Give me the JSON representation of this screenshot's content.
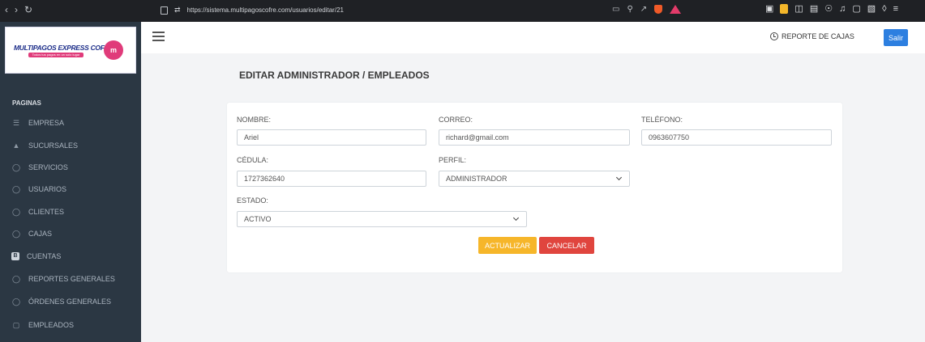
{
  "browser": {
    "url": "https://sistema.multipagoscofre.com/usuarios/editar/21"
  },
  "logo": {
    "title": "MULTIPAGOS EXPRESS COFRE",
    "tagline": "Todos tus pagos en un solo lugar",
    "badge": "m"
  },
  "sidebar": {
    "section": "PAGINAS",
    "items": [
      {
        "label": "EMPRESA",
        "icon": "sliders-icon"
      },
      {
        "label": "SUCURSALES",
        "icon": "sitemap-icon"
      },
      {
        "label": "SERVICIOS",
        "icon": "user-icon"
      },
      {
        "label": "USUARIOS",
        "icon": "user-icon"
      },
      {
        "label": "CLIENTES",
        "icon": "user-icon"
      },
      {
        "label": "CAJAS",
        "icon": "user-icon"
      },
      {
        "label": "CUENTAS",
        "icon": "bootstrap-icon"
      },
      {
        "label": "REPORTES GENERALES",
        "icon": "user-icon"
      },
      {
        "label": "ÓRDENES GENERALES",
        "icon": "user-icon"
      },
      {
        "label": "EMPLEADOS",
        "icon": "id-card-icon"
      }
    ]
  },
  "header": {
    "reporte_label": "REPORTE DE CAJAS",
    "salir_label": "Salir"
  },
  "page": {
    "title": "EDITAR ADMINISTRADOR / EMPLEADOS"
  },
  "form": {
    "nombre_label": "NOMBRE:",
    "nombre_value": "Ariel",
    "correo_label": "CORREO:",
    "correo_value": "richard@gmail.com",
    "telefono_label": "TELÉFONO:",
    "telefono_value": "0963607750",
    "cedula_label": "CÉDULA:",
    "cedula_value": "1727362640",
    "perfil_label": "PERFIL:",
    "perfil_value": "ADMINISTRADOR",
    "estado_label": "ESTADO:",
    "estado_value": "ACTIVO",
    "actualizar_label": "ACTUALIZAR",
    "cancelar_label": "CANCELAR"
  },
  "colors": {
    "sidebar_bg": "#2b3743",
    "accent_blue": "#2d7fe0",
    "update_btn": "#f6b62a",
    "cancel_btn": "#e0453e"
  }
}
